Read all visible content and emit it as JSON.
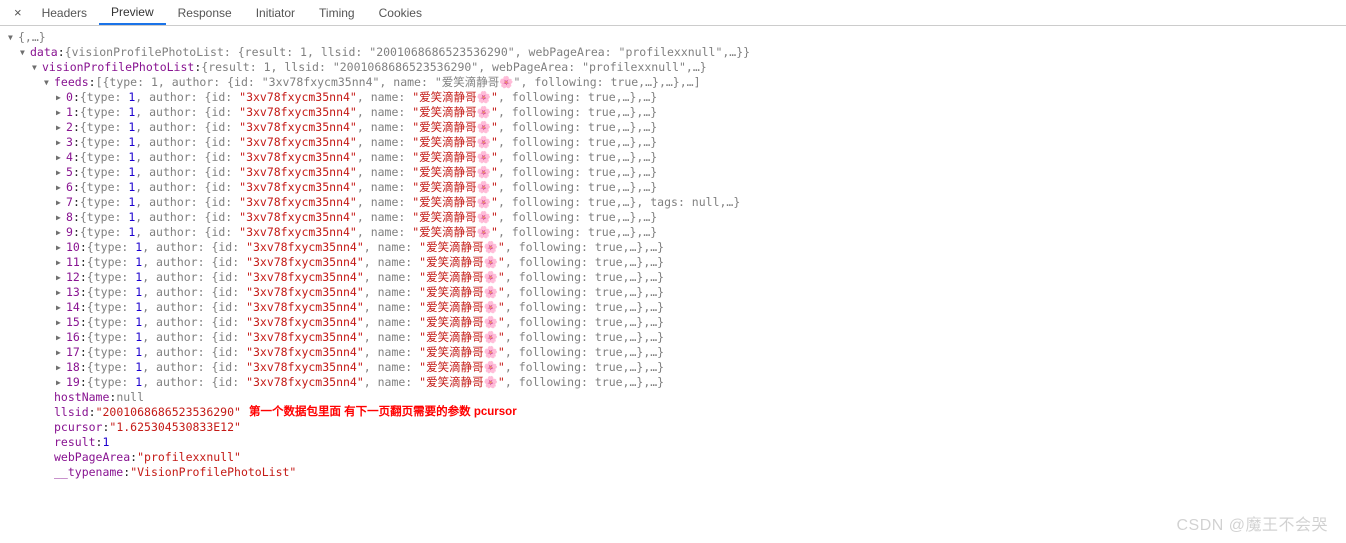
{
  "tabs": {
    "close": "×",
    "items": [
      "Headers",
      "Preview",
      "Response",
      "Initiator",
      "Timing",
      "Cookies"
    ],
    "activeIndex": 1
  },
  "tree": {
    "root_preview": "{,…}",
    "data_key": "data",
    "data_preview": "{visionProfilePhotoList: {result: 1, llsid: \"2001068686523536290\", webPageArea: \"profilexxnull\",…}}",
    "vp_key": "visionProfilePhotoList",
    "vp_preview": "{result: 1, llsid: \"2001068686523536290\", webPageArea: \"profilexxnull\",…}",
    "feeds_key": "feeds",
    "feeds_preview": "[{type: 1, author: {id: \"3xv78fxycm35nn4\", name: \"爱笑滴静哥🌸\", following: true,…},…},…]",
    "feed_item_preview": "{type: 1, author: {id: \"3xv78fxycm35nn4\", name: \"爱笑滴静哥🌸\", following: true,…},…}",
    "feed_item_7_preview": "{type: 1, author: {id: \"3xv78fxycm35nn4\", name: \"爱笑滴静哥🌸\", following: true,…}, tags: null,…}",
    "author_id": "3xv78fxycm35nn4",
    "author_name_text": "爱笑滴静哥",
    "flower": "🌸",
    "following": "true",
    "type_val": "1",
    "hostName_key": "hostName",
    "hostName_val": "null",
    "llsid_key": "llsid",
    "llsid_val": "\"2001068686523536290\"",
    "annotation": "第一个数据包里面 有下一页翻页需要的参数 pcursor",
    "pcursor_key": "pcursor",
    "pcursor_val": "\"1.625304530833E12\"",
    "result_key": "result",
    "result_val": "1",
    "webPageArea_key": "webPageArea",
    "webPageArea_val": "\"profilexxnull\"",
    "typename_key": "__typename",
    "typename_val": "\"VisionProfilePhotoList\"",
    "feed_indices": [
      0,
      1,
      2,
      3,
      4,
      5,
      6,
      7,
      8,
      9,
      10,
      11,
      12,
      13,
      14,
      15,
      16,
      17,
      18,
      19
    ]
  },
  "watermark": "CSDN @魔王不会哭"
}
